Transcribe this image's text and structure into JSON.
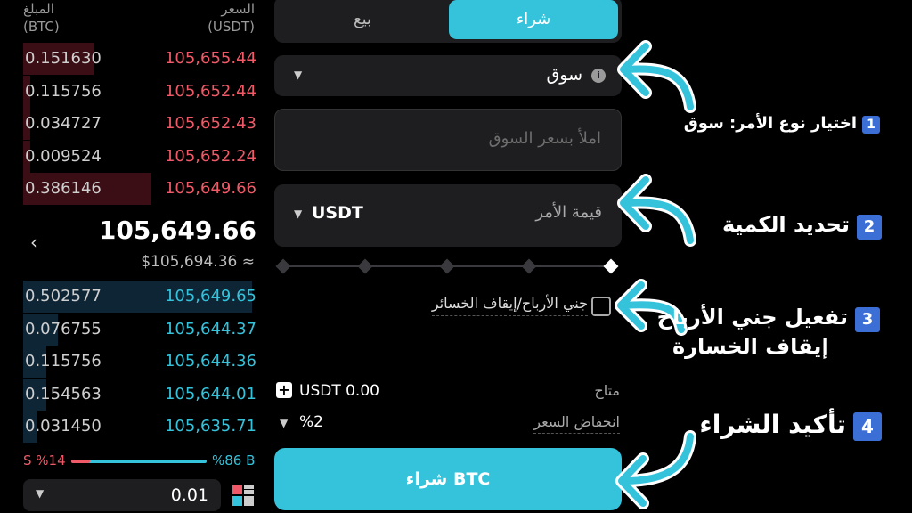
{
  "order_book": {
    "header": {
      "amount_label": "المبلغ",
      "amount_unit": "(BTC)",
      "price_label": "السعر",
      "price_unit": "(USDT)"
    },
    "asks": [
      {
        "amount": "0.151630",
        "price": "105,655.44",
        "depth": 0.3
      },
      {
        "amount": "0.115756",
        "price": "105,652.44",
        "depth": 0.03
      },
      {
        "amount": "0.034727",
        "price": "105,652.43",
        "depth": 0.03
      },
      {
        "amount": "0.009524",
        "price": "105,652.24",
        "depth": 0.03
      },
      {
        "amount": "0.386146",
        "price": "105,649.66",
        "depth": 0.55
      }
    ],
    "last_price": "105,649.66",
    "last_price_usd": "$105,694.36 ≈",
    "bids": [
      {
        "amount": "0.502577",
        "price": "105,649.65",
        "depth": 0.98
      },
      {
        "amount": "0.076755",
        "price": "105,644.37",
        "depth": 0.15
      },
      {
        "amount": "0.115756",
        "price": "105,644.36",
        "depth": 0.1
      },
      {
        "amount": "0.154563",
        "price": "105,644.01",
        "depth": 0.1
      },
      {
        "amount": "0.031450",
        "price": "105,635.71",
        "depth": 0.06
      }
    ],
    "ratio": {
      "sell_label": "S %14",
      "buy_label": "%86 B",
      "sell_fraction": 0.14
    },
    "precision": "0.01",
    "colors": {
      "ask": "#f05a68",
      "bid": "#35c3dc"
    }
  },
  "trade_panel": {
    "tabs": {
      "buy": "شراء",
      "sell": "بيع"
    },
    "order_type": {
      "value": "سوق",
      "info_icon": "i"
    },
    "price_field": {
      "placeholder": "املأ بسعر السوق"
    },
    "amount_field": {
      "label": "قيمة الأمر",
      "currency": "USDT"
    },
    "slider": {
      "steps": 5,
      "selected_index": 4
    },
    "tpsl": {
      "label": "جني الأرباح/إيقاف الخسائر",
      "checked": false
    },
    "available": {
      "label": "متاح",
      "value": "USDT 0.00",
      "plus": "+"
    },
    "slippage": {
      "label": "انخفاض السعر",
      "value": "%2"
    },
    "buy_button": "شراء BTC",
    "accent": "#35c3dc"
  },
  "annotations": [
    {
      "badge": "1",
      "text": "اختيار نوع الأمر: سوق"
    },
    {
      "badge": "2",
      "text": "تحديد الكمية"
    },
    {
      "badge": "3",
      "line1": "تفعيل جني الأرباح",
      "line2": "إيقاف الخسارة"
    },
    {
      "badge": "4",
      "text": "تأكيد الشراء"
    }
  ]
}
